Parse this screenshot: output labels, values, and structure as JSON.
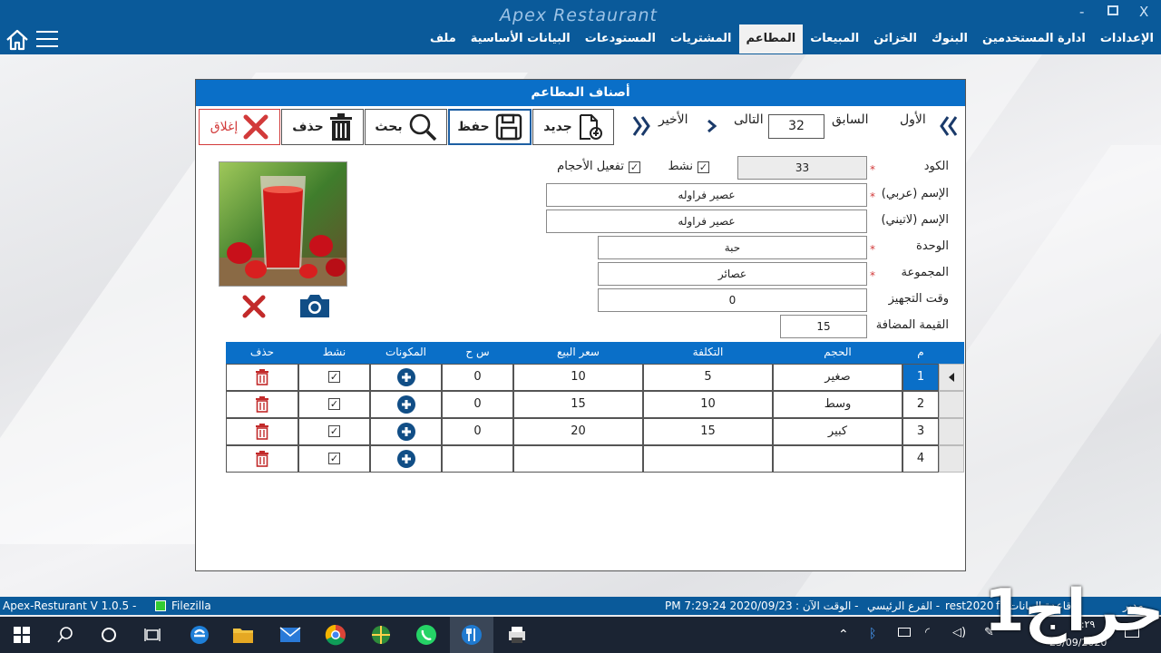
{
  "app": {
    "title": "Apex Restaurant",
    "close_glyph": "X",
    "min_glyph": "-",
    "max_glyph": "□"
  },
  "menu": [
    "ملف",
    "البيانات الأساسية",
    "المستودعات",
    "المشتريات",
    "المطاعم",
    "المبيعات",
    "الخزائن",
    "البنوك",
    "ادارة المستخدمين",
    "الإعدادات"
  ],
  "menu_active_index": 4,
  "window": {
    "title": "أصناف المطاعم"
  },
  "toolbar": {
    "new": "جديد",
    "save": "حفظ",
    "search": "بحث",
    "delete": "حذف",
    "close": "إغلاق"
  },
  "navigator": {
    "first": "الأول",
    "prev": "السابق",
    "record": "32",
    "next": "التالى",
    "last": "الأخير"
  },
  "form": {
    "code_label": "الكود",
    "code_value": "33",
    "active_label": "نشط",
    "active_checked": true,
    "sizes_label": "تفعيل الأحجام",
    "sizes_checked": true,
    "name_ar_label": "الإسم (عربي)",
    "name_ar_value": "عصير فراوله",
    "name_en_label": "الإسم (لاتيني)",
    "name_en_value": "عصير فراوله",
    "unit_label": "الوحدة",
    "unit_value": "حبة",
    "group_label": "المجموعة",
    "group_value": "عصائر",
    "prep_label": "وقت التجهيز",
    "prep_value": "0",
    "vat_label": "القيمة المضافة",
    "vat_value": "15",
    "required_mark": "*"
  },
  "grid": {
    "headers": {
      "no": "م",
      "size": "الحجم",
      "cost": "التكلفة",
      "price": "سعر البيع",
      "sh": "س ح",
      "components": "المكونات",
      "active": "نشط",
      "delete": "حذف"
    },
    "rows": [
      {
        "no": "1",
        "size": "صغير",
        "cost": "5",
        "price": "10",
        "sh": "0"
      },
      {
        "no": "2",
        "size": "وسط",
        "cost": "10",
        "price": "15",
        "sh": "0"
      },
      {
        "no": "3",
        "size": "كبير",
        "cost": "15",
        "price": "20",
        "sh": "0"
      },
      {
        "no": "4",
        "size": "",
        "cost": "",
        "price": "",
        "sh": ""
      }
    ]
  },
  "status": {
    "version": "Apex-Resturant V 1.0.5  -",
    "ftp": "Filezilla",
    "datetime": "PM 7:29:24 2020/09/23",
    "now_label": "-  الوقت الآن :",
    "branch": "-  الفرع الرئيسي",
    "db": "rest2020",
    "db_tail": "f",
    "db_label": "-  قاعدة البيانات",
    "user": "مدير"
  },
  "taskbar": {
    "date": "23/09/2020",
    "time": "١٩:٢٩"
  },
  "watermark": "حراج1",
  "colors": {
    "accent": "#0a6fc8",
    "topbar": "#0a5a9a",
    "danger": "#d23a3a"
  }
}
